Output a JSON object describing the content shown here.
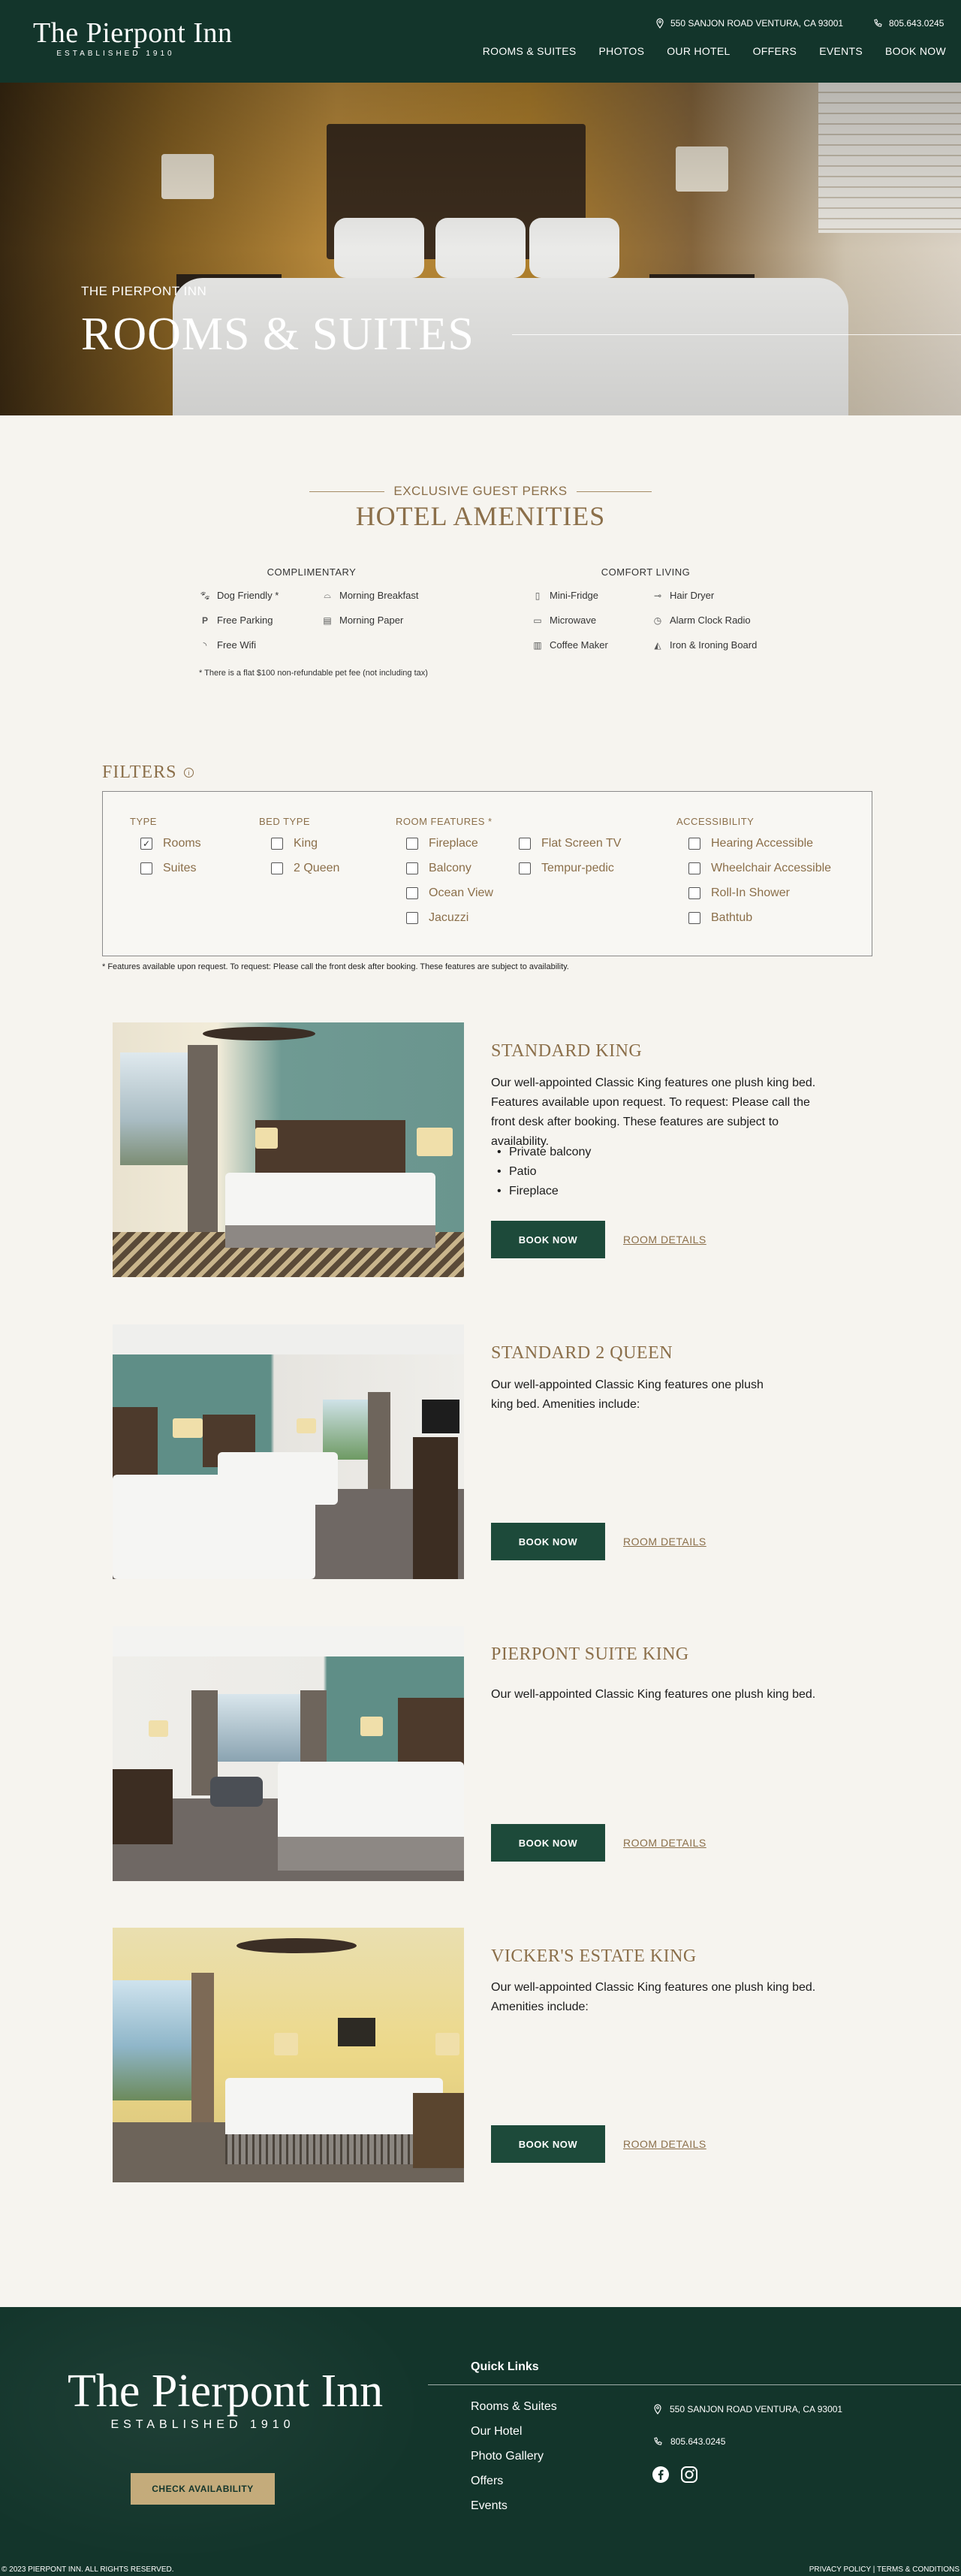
{
  "header": {
    "logo_name": "The Pierpont Inn",
    "logo_established": "ESTABLISHED 1910",
    "address": "550 SANJON ROAD VENTURA, CA 93001",
    "phone": "805.643.0245",
    "nav": [
      "ROOMS & SUITES",
      "PHOTOS",
      "OUR HOTEL",
      "OFFERS",
      "EVENTS",
      "BOOK NOW"
    ]
  },
  "hero": {
    "kicker": "THE PIERPONT INN",
    "title": "ROOMS & SUITES"
  },
  "amenities": {
    "kicker": "EXCLUSIVE GUEST PERKS",
    "title": "HOTEL AMENITIES",
    "complimentary": {
      "heading": "COMPLIMENTARY",
      "items": [
        "Dog Friendly *",
        "Morning Breakfast",
        "Free Parking",
        "Morning Paper",
        "Free Wifi"
      ]
    },
    "comfort": {
      "heading": "COMFORT LIVING",
      "items": [
        "Mini-Fridge",
        "Hair Dryer",
        "Microwave",
        "Alarm Clock Radio",
        "Coffee Maker",
        "Iron & Ironing Board"
      ]
    },
    "note": "* There is a flat $100 non-refundable pet fee (not including tax)"
  },
  "filters": {
    "title": "FILTERS",
    "groups": {
      "type": {
        "label": "TYPE",
        "options": [
          "Rooms",
          "Suites"
        ]
      },
      "bed_type": {
        "label": "BED TYPE",
        "options": [
          "King",
          "2 Queen"
        ]
      },
      "room_features": {
        "label": "ROOM FEATURES *",
        "options": [
          "Fireplace",
          "Balcony",
          "Ocean View",
          "Jacuzzi",
          "Flat Screen TV",
          "Tempur-pedic"
        ]
      },
      "accessibility": {
        "label": "ACCESSIBILITY",
        "options": [
          "Hearing Accessible",
          "Wheelchair Accessible",
          "Roll-In Shower",
          "Bathtub"
        ]
      }
    },
    "checkmark": "✓",
    "note": "* Features available upon request. To request: Please call the front desk after booking. These features are subject to availability."
  },
  "rooms": [
    {
      "title": "STANDARD KING",
      "description": "Our well-appointed Classic King features one plush king bed. Features available upon request. To request: Please call the front desk after booking. These features are subject to availability.",
      "bullets": [
        "Private balcony",
        "Patio",
        "Fireplace"
      ],
      "book_label": "BOOK NOW",
      "details_label": "ROOM DETAILS"
    },
    {
      "title": "STANDARD 2 QUEEN",
      "description": "Our well-appointed Classic King features one plush king bed. Amenities include:",
      "book_label": "BOOK NOW",
      "details_label": "ROOM DETAILS"
    },
    {
      "title": "PIERPONT SUITE KING",
      "description": "Our well-appointed Classic King features one plush king bed.",
      "book_label": "BOOK NOW",
      "details_label": "ROOM DETAILS"
    },
    {
      "title": "VICKER'S ESTATE KING",
      "description": "Our well-appointed Classic King features one plush king bed. Amenities include:",
      "book_label": "BOOK NOW",
      "details_label": "ROOM DETAILS"
    }
  ],
  "footer": {
    "logo_name": "The Pierpont Inn",
    "logo_established": "ESTABLISHED 1910",
    "cta": "CHECK AVAILABILITY",
    "quick_links_title": "Quick Links",
    "links": [
      "Rooms & Suites",
      "Our Hotel",
      "Photo Gallery",
      "Offers",
      "Events"
    ],
    "address": "550 SANJON ROAD VENTURA, CA 93001",
    "phone": "805.643.0245",
    "social_icons": [
      "facebook-icon",
      "instagram-icon"
    ],
    "copyright": "© 2023 PIERPONT INN. ALL RIGHTS RESERVED.",
    "legal": "PRIVACY POLICY | TERMS & CONDITIONS"
  },
  "colors": {
    "brand_green": "#13352b",
    "button_green": "#1d4a3a",
    "gold": "#8b6f4a",
    "cta_gold": "#c4ab7b",
    "page_bg": "#f6f4ef"
  }
}
